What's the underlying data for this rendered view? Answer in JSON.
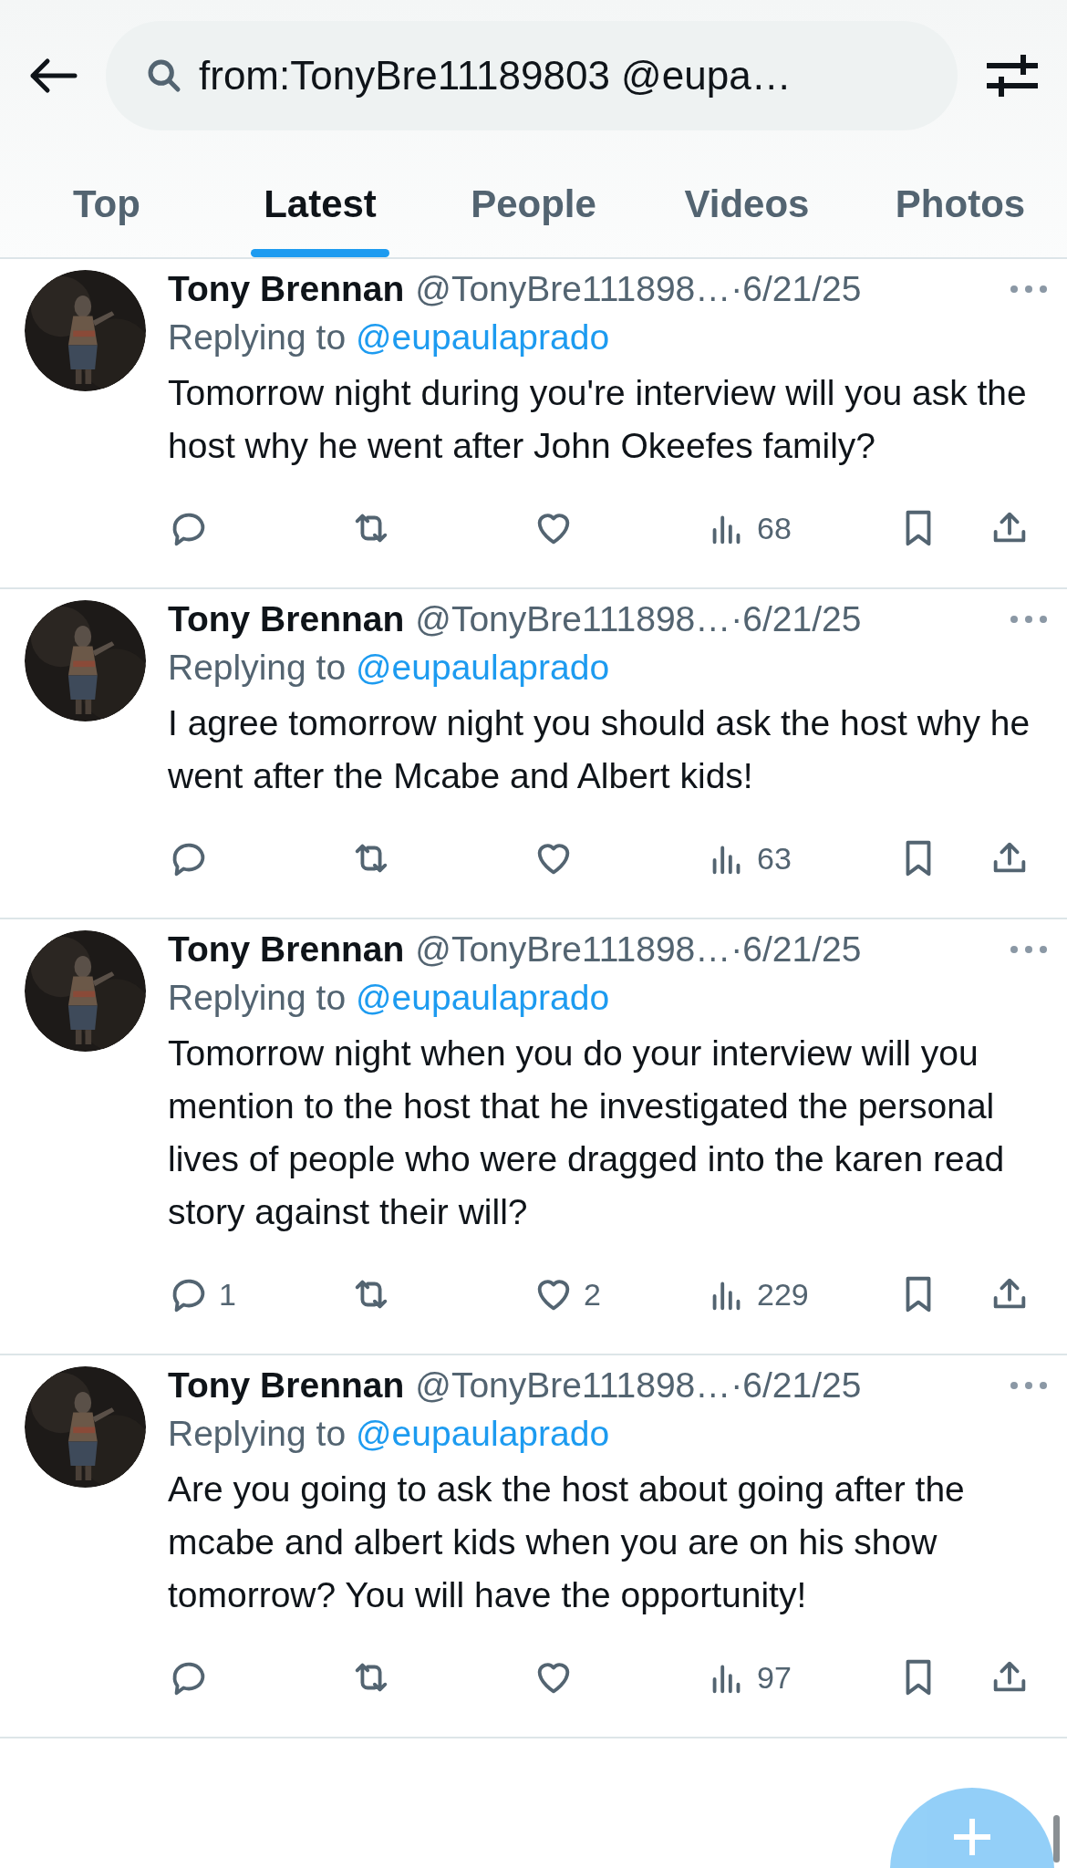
{
  "header": {
    "search": {
      "value": "from:TonyBre11189803 @eupa…"
    }
  },
  "tabs": [
    {
      "label": "Top",
      "selected": false
    },
    {
      "label": "Latest",
      "selected": true
    },
    {
      "label": "People",
      "selected": false
    },
    {
      "label": "Videos",
      "selected": false
    },
    {
      "label": "Photos",
      "selected": false
    }
  ],
  "tweets": [
    {
      "name": "Tony Brennan",
      "handle": "@TonyBre111898…",
      "separator": "·",
      "date": "6/21/25",
      "replying_label": "Replying to",
      "reply_to": "@eupaulaprado",
      "text": "Tomorrow night during you're interview will you ask the host why he went after John Okeefes family?",
      "views": "68"
    },
    {
      "name": "Tony Brennan",
      "handle": "@TonyBre111898…",
      "separator": "·",
      "date": "6/21/25",
      "replying_label": "Replying to",
      "reply_to": "@eupaulaprado",
      "text": "I agree tomorrow night you should ask the host why he went after the Mcabe and Albert kids!",
      "views": "63"
    },
    {
      "name": "Tony Brennan",
      "handle": "@TonyBre111898…",
      "separator": "·",
      "date": "6/21/25",
      "replying_label": "Replying to",
      "reply_to": "@eupaulaprado",
      "text": "Tomorrow night when you do your interview will you mention to the host that he investigated the personal lives of people who were dragged into the karen read story against their will?",
      "replies": "1",
      "likes": "2",
      "views": "229"
    },
    {
      "name": "Tony Brennan",
      "handle": "@TonyBre111898…",
      "separator": "·",
      "date": "6/21/25",
      "replying_label": "Replying to",
      "reply_to": "@eupaulaprado",
      "text": "Are you going to ask the host about going after the mcabe and albert kids when you are on his show tomorrow? You will have the opportunity!",
      "views": "97"
    }
  ]
}
